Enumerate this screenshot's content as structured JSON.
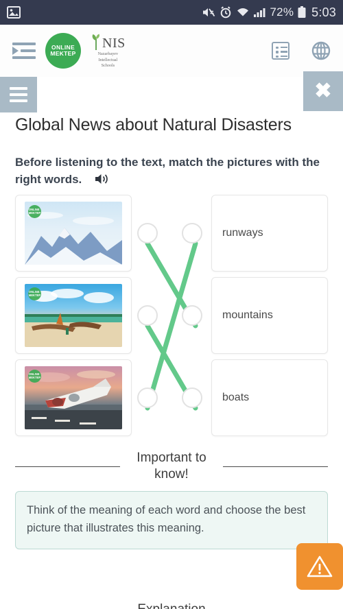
{
  "statusbar": {
    "left_icon": "photo-icon",
    "icons": [
      "mute-icon",
      "alarm-icon",
      "wifi-icon",
      "signal-icon"
    ],
    "battery_pct": "72%",
    "time": "5:03"
  },
  "header": {
    "indent_icon": "indent-menu-icon",
    "logo_online_mektep": {
      "line1": "ONLINE",
      "line2": "MEKTEP"
    },
    "logo_nis": {
      "abbr": "NIS",
      "sub1": "Nazarbayev",
      "sub2": "Intellectual",
      "sub3": "Schools"
    },
    "contents_icon": "list-contents-icon",
    "language_icon": "globe-icon"
  },
  "menu": {
    "hamburger_icon": "hamburger-menu-icon",
    "close_label": "✖"
  },
  "page": {
    "title": "Global News about Natural Disasters",
    "instruction": "Before listening to the text, match the pictures with the right words.",
    "audio_icon": "speaker-icon"
  },
  "exercise": {
    "type": "match-pictures-to-words",
    "pictures": [
      {
        "id": "pic-mountains",
        "alt": "snowy mountain peaks",
        "watermark": "ONLINE MEKTEP"
      },
      {
        "id": "pic-boats",
        "alt": "wooden boats on a tropical beach",
        "watermark": "ONLINE MEKTEP"
      },
      {
        "id": "pic-runway",
        "alt": "airplane taking off from a runway at sunset",
        "watermark": "ONLINE MEKTEP"
      }
    ],
    "words": [
      "runways",
      "mountains",
      "boats"
    ],
    "connections": [
      {
        "from_picture": 0,
        "to_word": 1
      },
      {
        "from_picture": 1,
        "to_word": 2
      },
      {
        "from_picture": 2,
        "to_word": 0
      }
    ],
    "line_color": "#63c98a"
  },
  "important": {
    "title_line1": "Important to",
    "title_line2": "know!",
    "tip": "Think of the meaning of each word and choose the best picture that illustrates this meaning.",
    "warning_icon": "warning-triangle-icon",
    "warning_color": "#f0912f"
  },
  "footer": {
    "peek_text": "Explanation"
  }
}
